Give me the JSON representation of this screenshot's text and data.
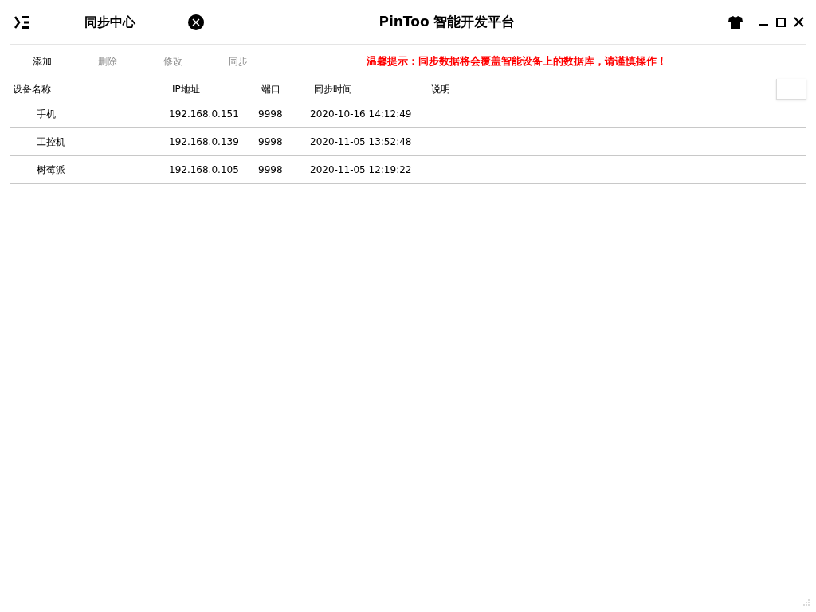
{
  "header": {
    "page_title": "同步中心",
    "app_title": "PinToo 智能开发平台"
  },
  "toolbar": [
    {
      "label": "添加",
      "disabled": false
    },
    {
      "label": "删除",
      "disabled": true
    },
    {
      "label": "修改",
      "disabled": true
    },
    {
      "label": "同步",
      "disabled": true
    }
  ],
  "notice": "温馨提示：同步数据将会覆盖智能设备上的数据库，请谨慎操作！",
  "table": {
    "columns": [
      "设备名称",
      "IP地址",
      "端口",
      "同步时间",
      "说明"
    ],
    "rows": [
      [
        "手机",
        "192.168.0.151",
        "9998",
        "2020-10-16 14:12:49"
      ],
      [
        "工控机",
        "192.168.0.139",
        "9998",
        "2020-11-05 13:52:48"
      ],
      [
        "树莓派",
        "192.168.0.105",
        "9998",
        "2020-11-05 12:19:22"
      ]
    ]
  }
}
